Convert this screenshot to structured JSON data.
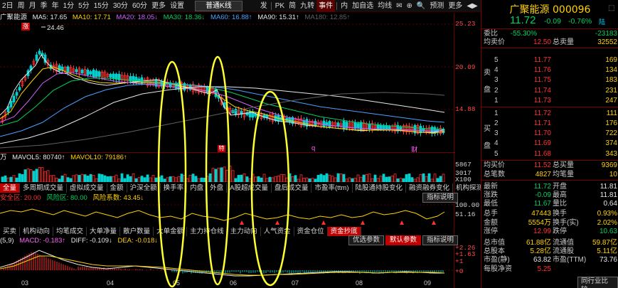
{
  "toolbar": {
    "items": [
      "2日",
      "周",
      "月",
      "季",
      "年",
      "1分",
      "5分",
      "15分",
      "30分",
      "60分",
      "更多",
      "设置"
    ],
    "mode": "普通K线",
    "right_items": [
      "发",
      "PK",
      "简",
      "九转",
      "事件",
      "内",
      "加自选",
      "均线",
      "✉",
      "⊕",
      "🔍",
      "预测",
      "更多",
      "◀▶"
    ],
    "event_label": "事件"
  },
  "ma_row": {
    "name": "广聚能源",
    "items": [
      {
        "label": "MA5: 17.65",
        "color": "#e8e8e8"
      },
      {
        "label": "MA10: 17.71",
        "color": "#ffd200"
      },
      {
        "label": "MA20: 18.05↓",
        "color": "#d060ff"
      },
      {
        "label": "MA30: 18.36↓",
        "color": "#00d060"
      },
      {
        "label": "MA60: 16.88↑",
        "color": "#4aa0ff"
      },
      {
        "label": "MA90: 15.31↑",
        "color": "#e8e8e8"
      },
      {
        "label": "MA180: 12.85↑",
        "color": "#606060"
      }
    ]
  },
  "price_axis": [
    "25.23",
    "20.09",
    "14.88"
  ],
  "high_label": "24.46",
  "low_label": "10.93",
  "chart_markers": [
    "涨",
    "特",
    "q",
    "财"
  ],
  "volume": {
    "label_prefix": "万",
    "mavol5": "MAVOL5: 80740↑",
    "mavol10": "MAVOL10: 79186↑",
    "axis": [
      "5867",
      "3017",
      "X100"
    ]
  },
  "tabs_row1": [
    "全量",
    "多周期成交量",
    "虚拟成交量",
    "金额",
    "沪深全额",
    "换手率",
    "内盘",
    "外盘",
    "A股超成交量",
    "盘后成交量",
    "市盈率(ttm)",
    "陆股通持股变化",
    "融资融券变化",
    "机构探测器"
  ],
  "tabs_row1_active": "全量",
  "indicator_btn": "指标说明",
  "risk": {
    "security": "安全区: 20.00",
    "risk_zone": "风险区: 80.00",
    "coef": "风险系数: 43.45↓",
    "axis": [
      "100.00",
      "51.16"
    ]
  },
  "tabs_row2": [
    "买卖",
    "机构动向",
    "均笔成交",
    "大单净量",
    "散户数量",
    "大单金额",
    "主力持仓线",
    "主力动向",
    "人气资金",
    "资金仓位",
    "资金抄底"
  ],
  "tabs_row2_active": "资金抄底",
  "macd": {
    "params": "(5,9)",
    "macd": "MACD: -0.183↑",
    "diff": "DIFF: -0.109↓",
    "dea": "DEA: -0.018↓",
    "axis": [
      "+2.26",
      "+1.63",
      "+1",
      "+0"
    ],
    "buttons": [
      "优选参数",
      "默认参数",
      "指标说明"
    ],
    "active_button": "默认参数"
  },
  "x_axis": [
    "03",
    "04",
    "05",
    "06",
    "07",
    "08",
    "09"
  ],
  "stock": {
    "name": "广聚能源",
    "code": "000096",
    "price": "11.72",
    "change": "-0.09",
    "change_pct": "-0.76%",
    "tag": "陆"
  },
  "ratio": {
    "label": "委比",
    "value": "-55.30%",
    "diff_label": "",
    "diff": "-23183"
  },
  "avg": {
    "label1": "均卖价",
    "value1": "12.50",
    "label2": "总卖量",
    "value2": "32552"
  },
  "asks": [
    {
      "lvl": "5",
      "price": "11.77",
      "vol": "169"
    },
    {
      "lvl": "4",
      "price": "11.76",
      "vol": "134"
    },
    {
      "lvl": "3",
      "price": "11.75",
      "vol": "183"
    },
    {
      "lvl": "2",
      "price": "11.74",
      "vol": "231"
    },
    {
      "lvl": "1",
      "price": "11.73",
      "vol": "247"
    }
  ],
  "ask_side": [
    "卖",
    "盘"
  ],
  "bids": [
    {
      "lvl": "1",
      "price": "11.72",
      "vol": "111"
    },
    {
      "lvl": "2",
      "price": "11.71",
      "vol": "176"
    },
    {
      "lvl": "3",
      "price": "11.70",
      "vol": "722"
    },
    {
      "lvl": "4",
      "price": "11.69",
      "vol": "374"
    },
    {
      "lvl": "5",
      "price": "11.68",
      "vol": "343"
    }
  ],
  "bid_side": [
    "买",
    "盘"
  ],
  "bid_avg": {
    "label1": "均买价",
    "value1": "11.52",
    "label2": "总买量",
    "value2": "9369"
  },
  "trades": {
    "label1": "总笔数",
    "value1": "4827",
    "label2": "均笔量",
    "value2": "10"
  },
  "quote": [
    {
      "l1": "最新",
      "v1": "11.72",
      "c1": "green",
      "l2": "开盘",
      "v2": "11.81",
      "c2": "white"
    },
    {
      "l1": "涨跌",
      "v1": "-0.09",
      "c1": "green",
      "l2": "最高",
      "v2": "11.81",
      "c2": "white"
    },
    {
      "l1": "最低",
      "v1": "11.67",
      "c1": "green",
      "l2": "量比",
      "v2": "0.64",
      "c2": "white"
    },
    {
      "l1": "总手",
      "v1": "47443",
      "c1": "yellow",
      "l2": "换手",
      "v2": "0.93%",
      "c2": "yellow"
    },
    {
      "l1": "金额",
      "v1": "5554万",
      "c1": "yellow",
      "l2": "换手(实)",
      "v2": "2.02%",
      "c2": "yellow"
    },
    {
      "l1": "涨停",
      "v1": "12.99",
      "c1": "red",
      "l2": "跌停",
      "v2": "10.63",
      "c2": "green"
    },
    {
      "l1": "总市值",
      "v1": "61.88亿",
      "c1": "yellow",
      "l2": "流通值",
      "v2": "59.87亿",
      "c2": "yellow"
    },
    {
      "l1": "总股本",
      "v1": "5.28亿",
      "c1": "yellow",
      "l2": "流通股",
      "v2": "5.11亿",
      "c2": "yellow"
    },
    {
      "l1": "市盈(静)",
      "v1": "63.82",
      "c1": "white",
      "l2": "市盈(TTM)",
      "v2": "73.76",
      "c2": "white"
    },
    {
      "l1": "每股净资",
      "v1": "5.25",
      "c1": "red",
      "l2": "",
      "v2": "",
      "c2": "white"
    }
  ],
  "bottom_button": "同行业比较",
  "colors": {
    "up": "#ff3030",
    "down": "#00d0d0",
    "annot": "#ffff30",
    "border": "#7a0000"
  }
}
